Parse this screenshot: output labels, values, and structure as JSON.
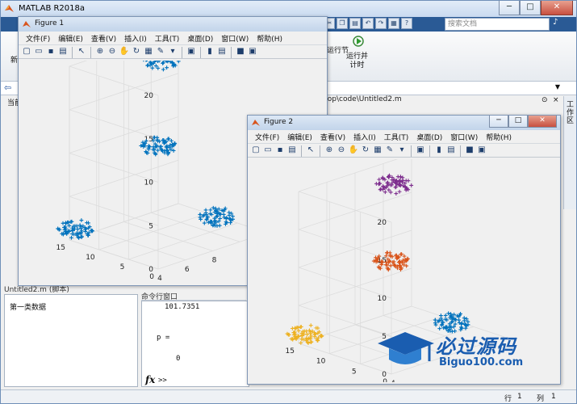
{
  "main_window": {
    "title": "MATLAB R2018a",
    "search_placeholder": "搜索文档",
    "ribbon_left": "新",
    "ribbon_run_section": "运行节",
    "ribbon_run_timed": "运行并\n计时",
    "path_tail": "ktop\\code\\Untitled2.m",
    "side_label": "工作区",
    "current_folder_stub": "当前",
    "editor_header": "Untitled2.m  (脚本)",
    "editor_line": "第一类数据",
    "cmd_header": "命令行窗口",
    "cmd_lines": [
      "101.7351",
      "p =",
      "0"
    ],
    "cmd_prompt": ">>",
    "status_row_label": "行",
    "status_row": "1",
    "status_col_label": "列",
    "status_col": "1"
  },
  "menus": [
    "文件(F)",
    "编辑(E)",
    "查看(V)",
    "插入(I)",
    "工具(T)",
    "桌面(D)",
    "窗口(W)",
    "帮助(H)"
  ],
  "figure1": {
    "title": "Figure 1",
    "chart_data": {
      "type": "scatter",
      "zticks": [
        "0",
        "5",
        "10",
        "15",
        "20"
      ],
      "yticks": [
        "0",
        "5",
        "10",
        "15"
      ],
      "xticks": [
        "4",
        "6",
        "8"
      ],
      "marker": "+",
      "series": [
        {
          "color": "#0072bd",
          "x": 4.0,
          "y": 14.0,
          "z": 1.5
        },
        {
          "color": "#0072bd",
          "x": 7.5,
          "y": 8.0,
          "z": 10.5
        },
        {
          "color": "#0072bd",
          "x": 9.0,
          "y": 11.0,
          "z": 19.0
        },
        {
          "color": "#0072bd",
          "x": 10.5,
          "y": 5.0,
          "z": 1.5
        }
      ],
      "xlim": [
        4,
        12
      ],
      "ylim": [
        0,
        15
      ],
      "zlim": [
        0,
        20
      ],
      "grid": true
    }
  },
  "figure2": {
    "title": "Figure 2",
    "chart_data": {
      "type": "scatter",
      "zticks": [
        "0",
        "5",
        "10",
        "15",
        "20"
      ],
      "yticks": [
        "0",
        "5",
        "10",
        "15"
      ],
      "xticks": [
        "4"
      ],
      "marker": "+",
      "series": [
        {
          "color": "#edb120",
          "x": 4.0,
          "y": 14.0,
          "z": 1.5
        },
        {
          "color": "#d95319",
          "x": 7.5,
          "y": 8.0,
          "z": 10.5
        },
        {
          "color": "#7e2f8e",
          "x": 9.0,
          "y": 11.0,
          "z": 19.0
        },
        {
          "color": "#0072bd",
          "x": 10.5,
          "y": 5.0,
          "z": 1.5
        }
      ],
      "xlim": [
        4,
        12
      ],
      "ylim": [
        0,
        15
      ],
      "zlim": [
        0,
        20
      ],
      "grid": true
    }
  },
  "watermark": {
    "cn": "必过源码",
    "en": "Biguo100.com"
  }
}
